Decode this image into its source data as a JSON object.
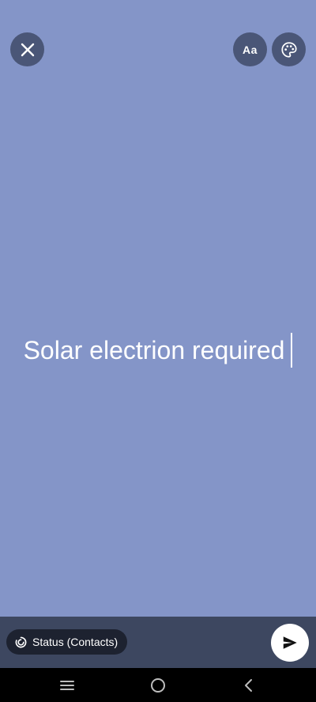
{
  "composer": {
    "status_text": "Solar electrion required",
    "background_color": "#8495c8"
  },
  "toolbar": {
    "close_icon": "close-icon",
    "font_label": "Aa",
    "palette_icon": "palette-icon"
  },
  "bottom_bar": {
    "audience_label": "Status (Contacts)",
    "audience_icon": "status-ring-icon",
    "send_icon": "send-icon"
  },
  "nav": {
    "recents_icon": "recents-icon",
    "home_icon": "home-icon",
    "back_icon": "back-icon"
  },
  "colors": {
    "accent_button": "#4a5677",
    "bottom_bar": "#3d4760",
    "chip": "#1d2230"
  }
}
